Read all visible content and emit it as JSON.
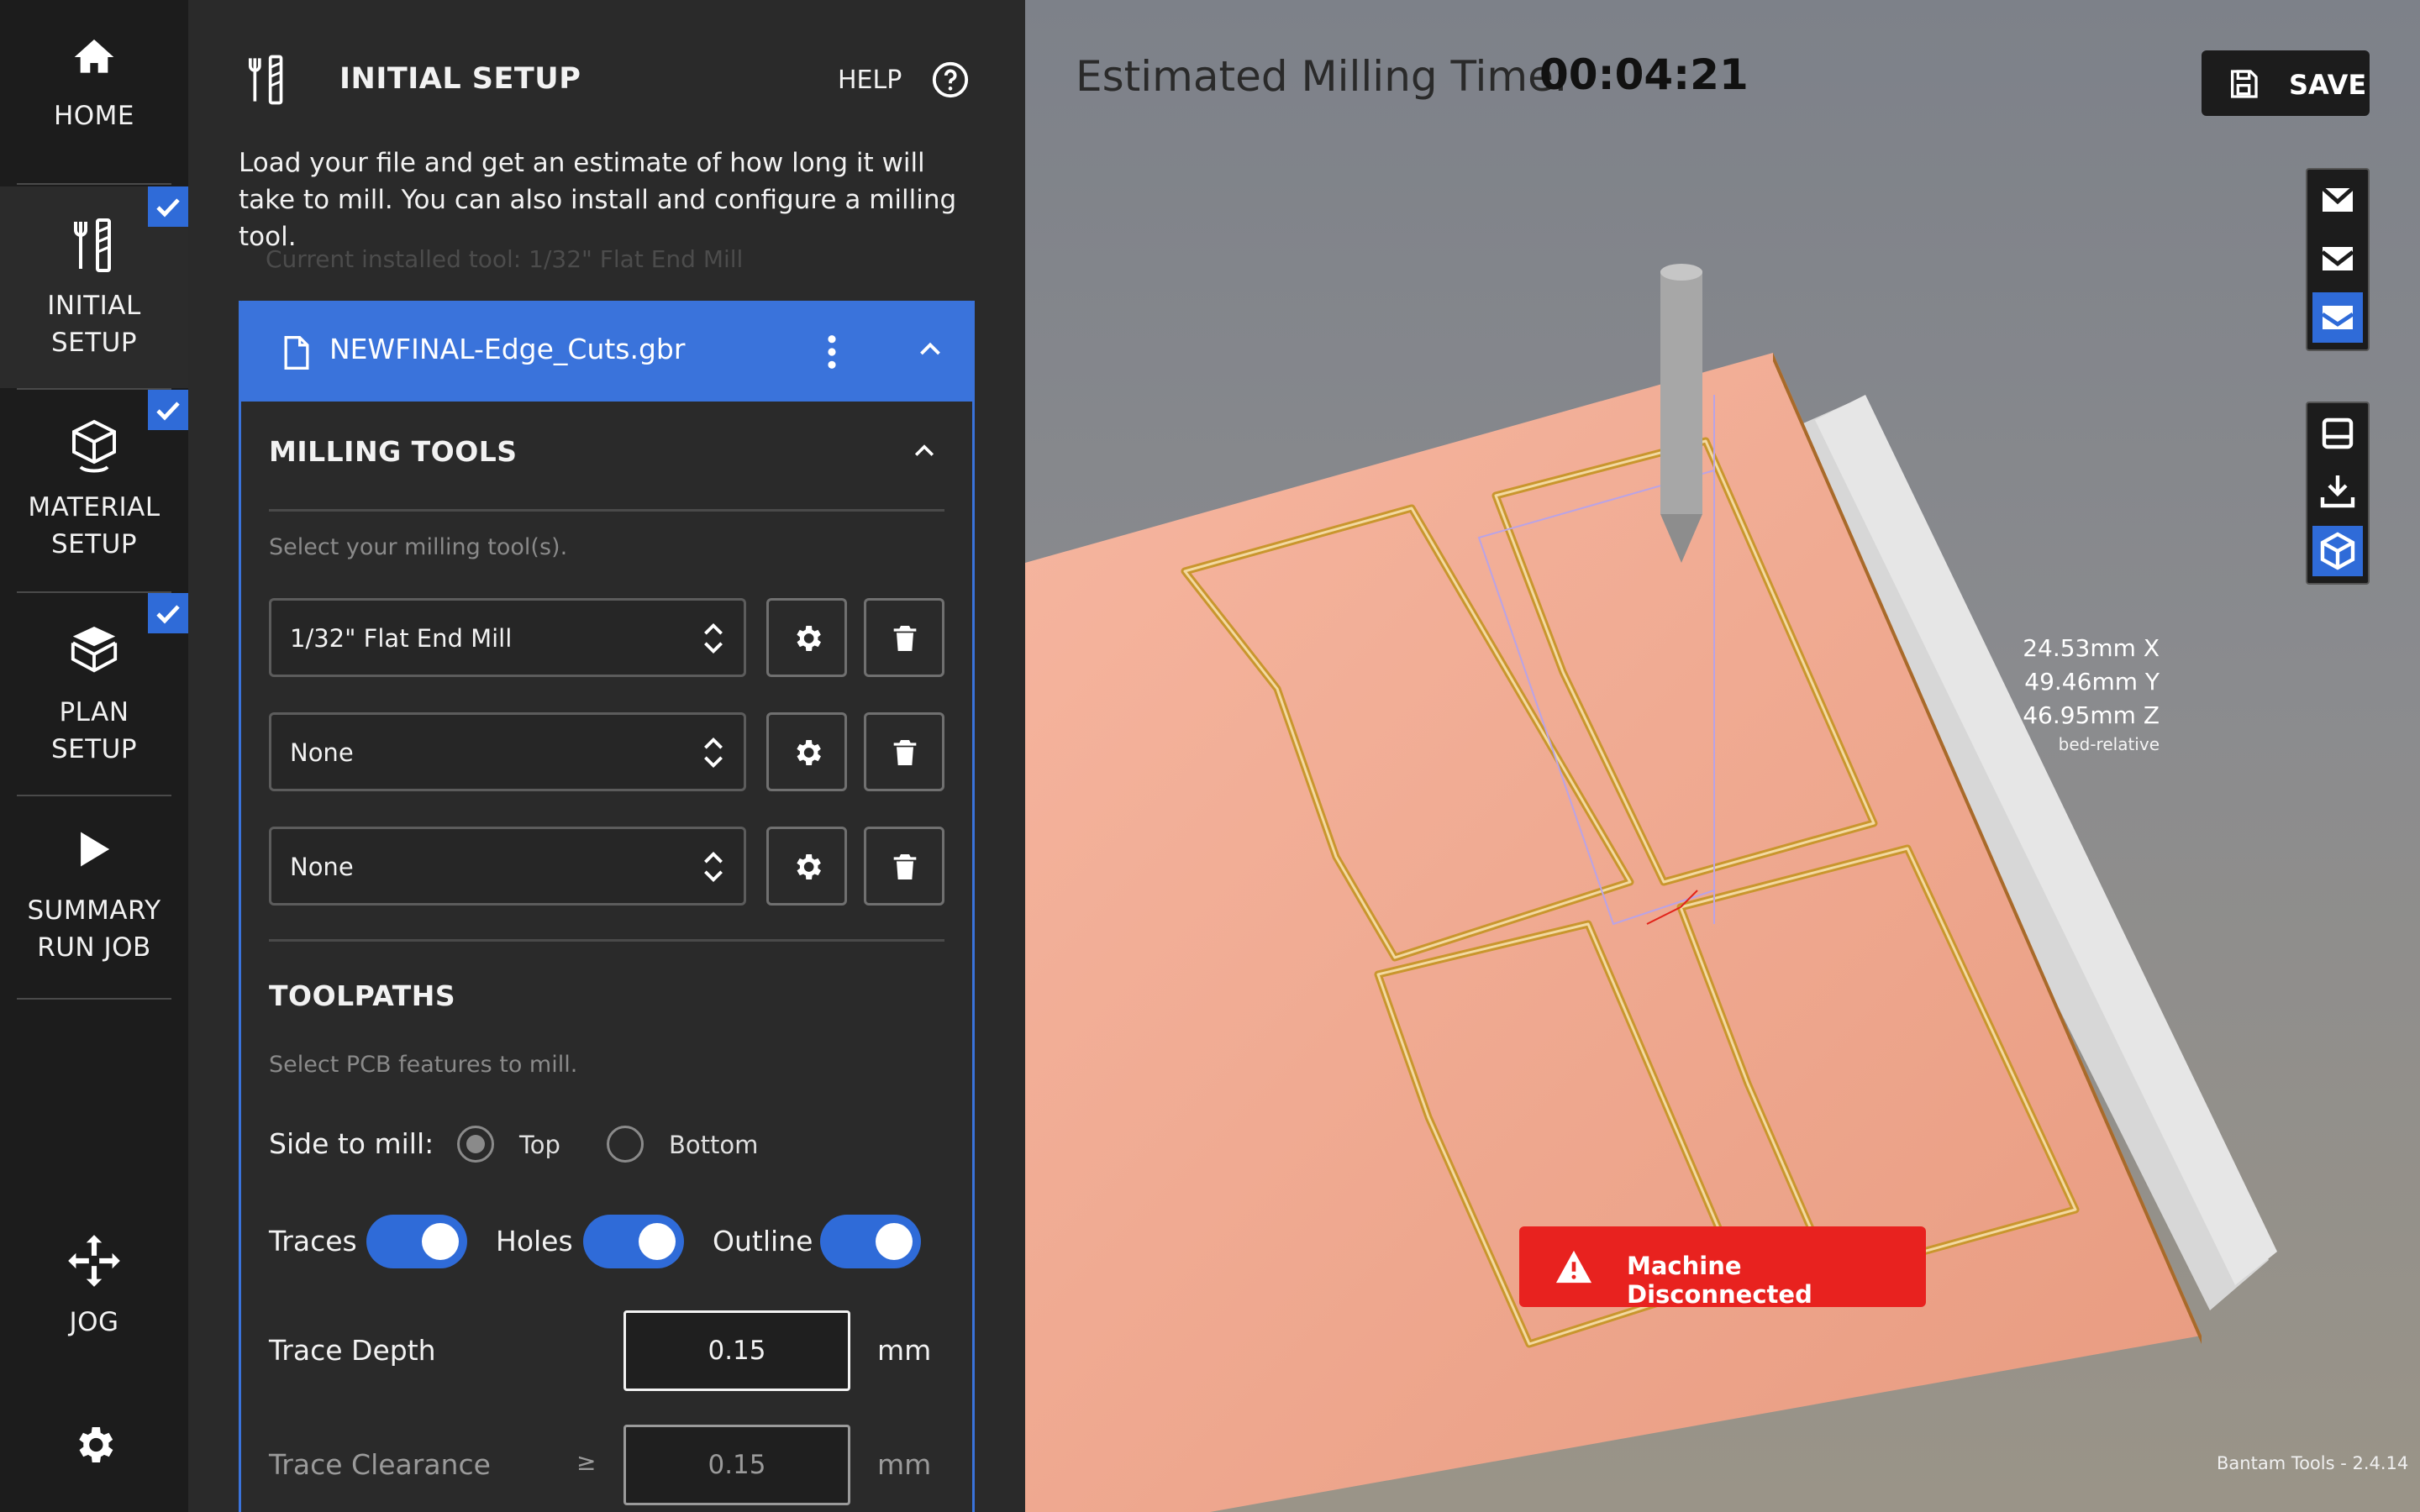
{
  "nav": {
    "home": "HOME",
    "initial_setup": [
      "INITIAL",
      "SETUP"
    ],
    "material_setup": [
      "MATERIAL",
      "SETUP"
    ],
    "plan_setup": [
      "PLAN",
      "SETUP"
    ],
    "summary": [
      "SUMMARY",
      "RUN JOB"
    ],
    "jog": "JOG"
  },
  "panel": {
    "title": "INITIAL SETUP",
    "help": "HELP",
    "intro": "Load your file and get an estimate of how long it will take to mill. You can also install and configure a milling tool.",
    "installed_tool": "Current installed tool: 1/32\" Flat End Mill",
    "file_name": "NEWFINAL-Edge_Cuts.gbr",
    "milling_tools": {
      "heading": "MILLING TOOLS",
      "hint": "Select your milling tool(s).",
      "tools": [
        "1/32\" Flat End Mill",
        "None",
        "None"
      ]
    },
    "toolpaths": {
      "heading": "TOOLPATHS",
      "hint": "Select PCB features to mill.",
      "side_label": "Side to mill:",
      "side_options": [
        "Top",
        "Bottom"
      ],
      "side_selected": "Top",
      "traces": "Traces",
      "holes": "Holes",
      "outline": "Outline",
      "traces_on": true,
      "holes_on": true,
      "outline_on": true,
      "trace_depth_label": "Trace Depth",
      "trace_depth": "0.15",
      "trace_depth_unit": "mm",
      "trace_clearance_label": "Trace Clearance",
      "trace_clearance_op": "≥",
      "trace_clearance": "0.15",
      "trace_clearance_unit": "mm"
    }
  },
  "viewport": {
    "est_label": "Estimated Milling Time:",
    "est_time": "00:04:21",
    "save": "SAVE",
    "coords": {
      "x": "24.53mm X",
      "y": "49.46mm Y",
      "z": "46.95mm Z",
      "ref": "bed-relative"
    },
    "alert": "Machine Disconnected",
    "version": "Bantam Tools - 2.4.14"
  },
  "colors": {
    "accent": "#2f6bd8",
    "alert": "#e8221f",
    "board": "#f2a88c"
  }
}
